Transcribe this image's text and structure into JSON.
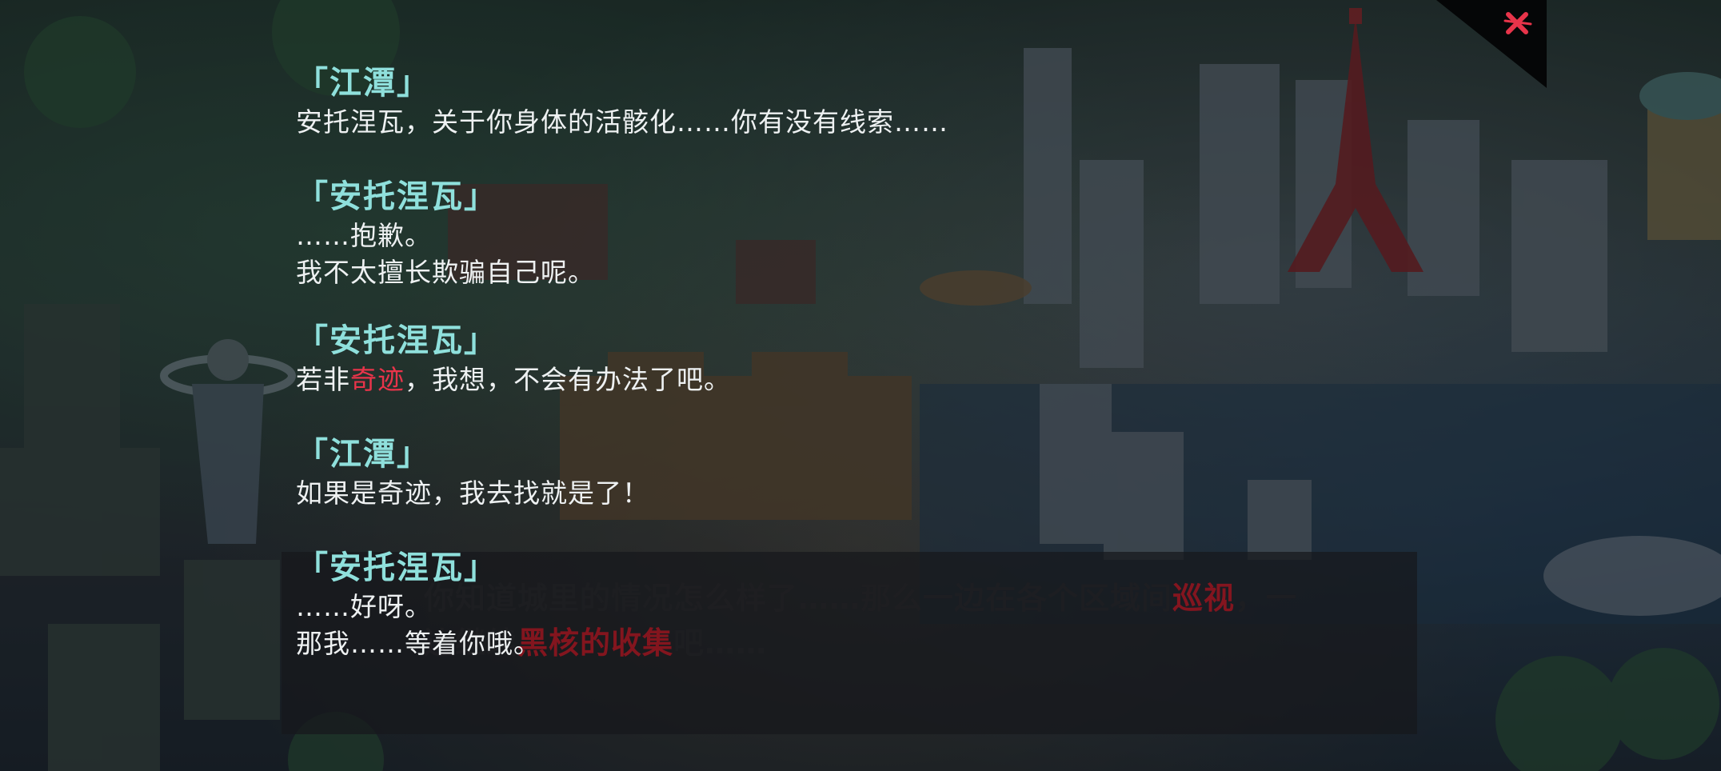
{
  "background_text": {
    "part1": "你知道城里的情况怎么样了……那么一边在各个区域间",
    "highlight1": "巡视",
    "part2": "，一边继续",
    "highlight2": "黑核的收集",
    "part3": "吧……"
  },
  "close_icon": "close-x-icon",
  "colors": {
    "speaker": "#8fe0dc",
    "text": "#eef1f2",
    "accent": "#e8344a",
    "close": "#e8344a"
  },
  "dialogue": [
    {
      "speaker": "「江潭」",
      "lines": [
        "安托涅瓦，关于你身体的活骸化……你有没有线索……"
      ]
    },
    {
      "speaker": "「安托涅瓦」",
      "lines": [
        "……抱歉。",
        "我不太擅长欺骗自己呢。"
      ]
    },
    {
      "speaker": "「安托涅瓦」",
      "lines_rich": {
        "before": "若非",
        "accent": "奇迹",
        "after": "，我想，不会有办法了吧。"
      }
    },
    {
      "speaker": "「江潭」",
      "lines": [
        "如果是奇迹，我去找就是了！"
      ]
    },
    {
      "speaker": "「安托涅瓦」",
      "lines": [
        "……好呀。",
        "那我……等着你哦。"
      ]
    }
  ]
}
